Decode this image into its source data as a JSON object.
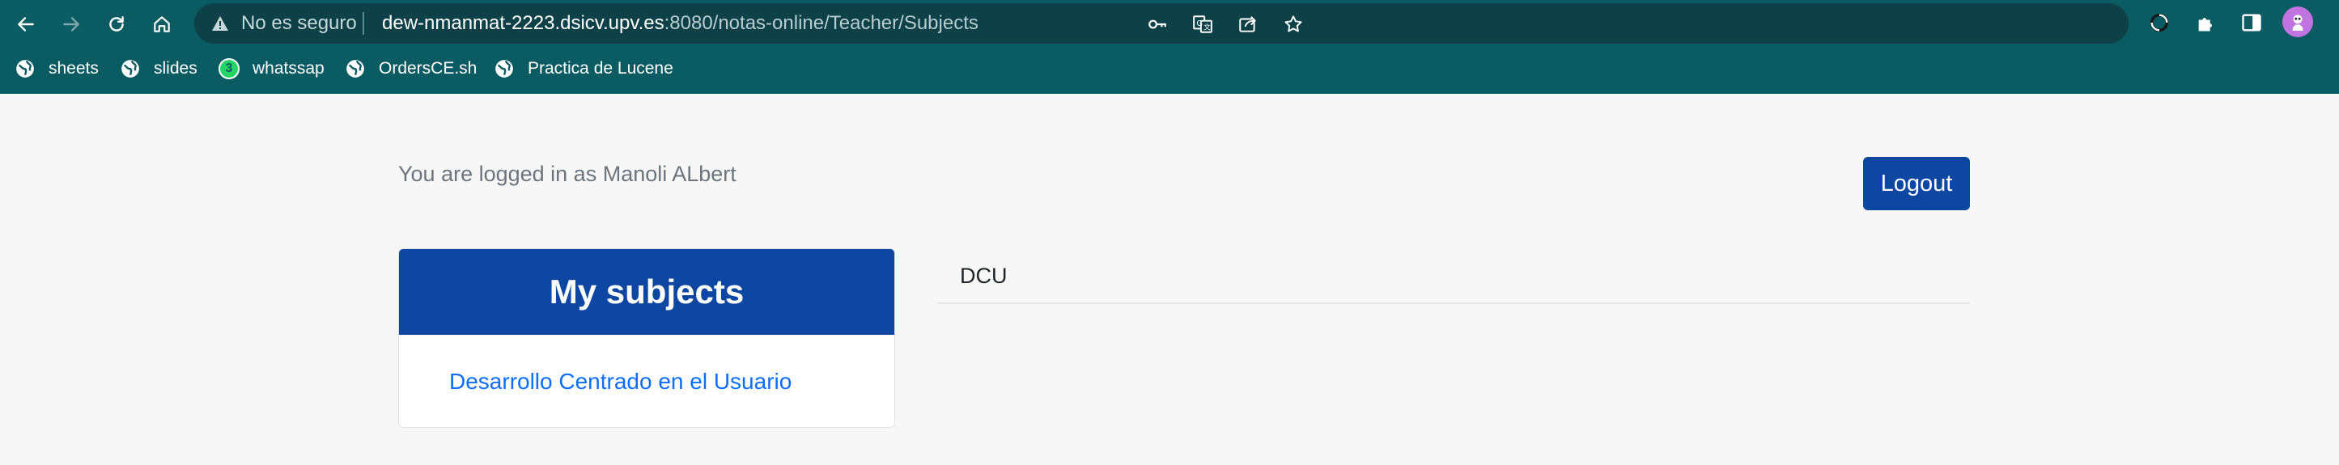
{
  "browser": {
    "security_label": "No es seguro",
    "url_host": "dew-nmanmat-2223.dsicv.upv.es",
    "url_rest": ":8080/notas-online/Teacher/Subjects",
    "nav_icons": [
      "back-arrow-icon",
      "forward-arrow-icon",
      "reload-icon",
      "home-icon"
    ],
    "omnibox_icons": [
      "key-icon",
      "translate-icon",
      "share-icon",
      "star-icon"
    ],
    "toolbar_icons": [
      "sync-icon",
      "puzzle-extensions-icon",
      "side-panel-icon",
      "profile-avatar-icon"
    ],
    "bookmarks": [
      {
        "label": "sheets",
        "icon": "globe-icon"
      },
      {
        "label": "slides",
        "icon": "globe-icon"
      },
      {
        "label": "whatssap",
        "icon": "whatsapp-icon",
        "badge": "3"
      },
      {
        "label": "OrdersCE.sh",
        "icon": "globe-icon"
      },
      {
        "label": "Practica de Lucene",
        "icon": "globe-icon"
      }
    ],
    "colors": {
      "toolbar": "#0b5b63",
      "omnibox": "#0d4047"
    }
  },
  "page": {
    "login_text": "You are logged in as Manoli ALbert",
    "logout_label": "Logout",
    "subjects_card": {
      "title": "My subjects",
      "items": [
        "Desarrollo Centrado en el Usuario"
      ]
    },
    "selected_subject": "DCU",
    "colors": {
      "primary": "#0d47a1",
      "link": "#0d6efd",
      "background": "#f7f7f7"
    }
  }
}
